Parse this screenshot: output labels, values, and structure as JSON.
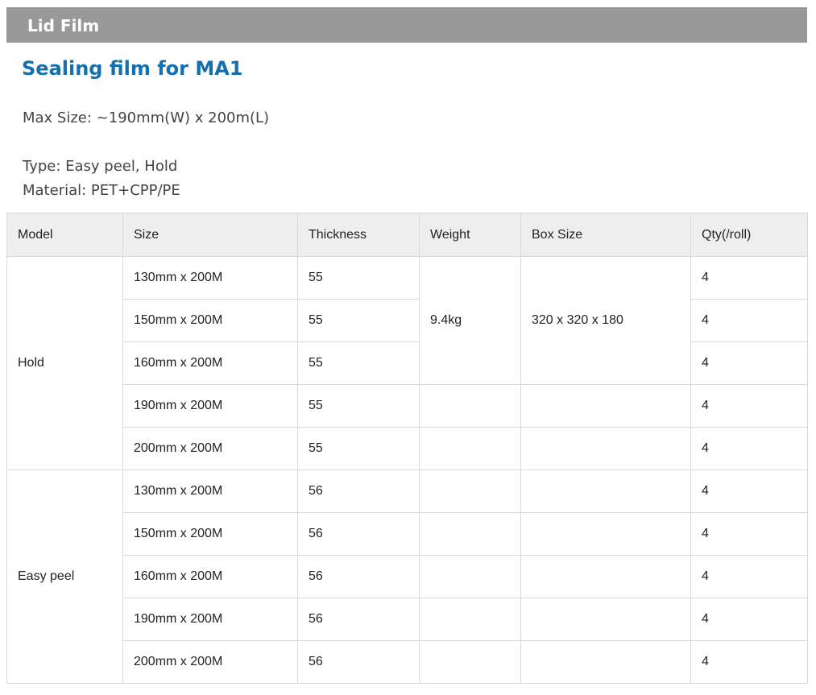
{
  "section": {
    "title": "Lid Film"
  },
  "product": {
    "title": "Sealing film for MA1",
    "max_size": "Max Size: ~190mm(W) x 200m(L)",
    "type": "Type: Easy peel, Hold",
    "material": "Material: PET+CPP/PE"
  },
  "table": {
    "headers": [
      "Model",
      "Size",
      "Thickness",
      "Weight",
      "Box Size",
      "Qty(/roll)"
    ],
    "groups": [
      {
        "model": "Hold",
        "rows": [
          {
            "size": "130mm x 200M",
            "thickness": "55",
            "qty": "4"
          },
          {
            "size": "150mm x 200M",
            "thickness": "55",
            "qty": "4"
          },
          {
            "size": "160mm x 200M",
            "thickness": "55",
            "qty": "4"
          },
          {
            "size": "190mm x 200M",
            "thickness": "55",
            "qty": "4"
          },
          {
            "size": "200mm x 200M",
            "thickness": "55",
            "qty": "4"
          }
        ]
      },
      {
        "model": "Easy peel",
        "rows": [
          {
            "size": "130mm x 200M",
            "thickness": "56",
            "qty": "4"
          },
          {
            "size": "150mm x 200M",
            "thickness": "56",
            "qty": "4"
          },
          {
            "size": "160mm x 200M",
            "thickness": "56",
            "qty": "4"
          },
          {
            "size": "190mm x 200M",
            "thickness": "56",
            "qty": "4"
          },
          {
            "size": "200mm x 200M",
            "thickness": "56",
            "qty": "4"
          }
        ]
      }
    ],
    "weight": "9.4kg",
    "box_size": "320 x 320 x 180"
  }
}
